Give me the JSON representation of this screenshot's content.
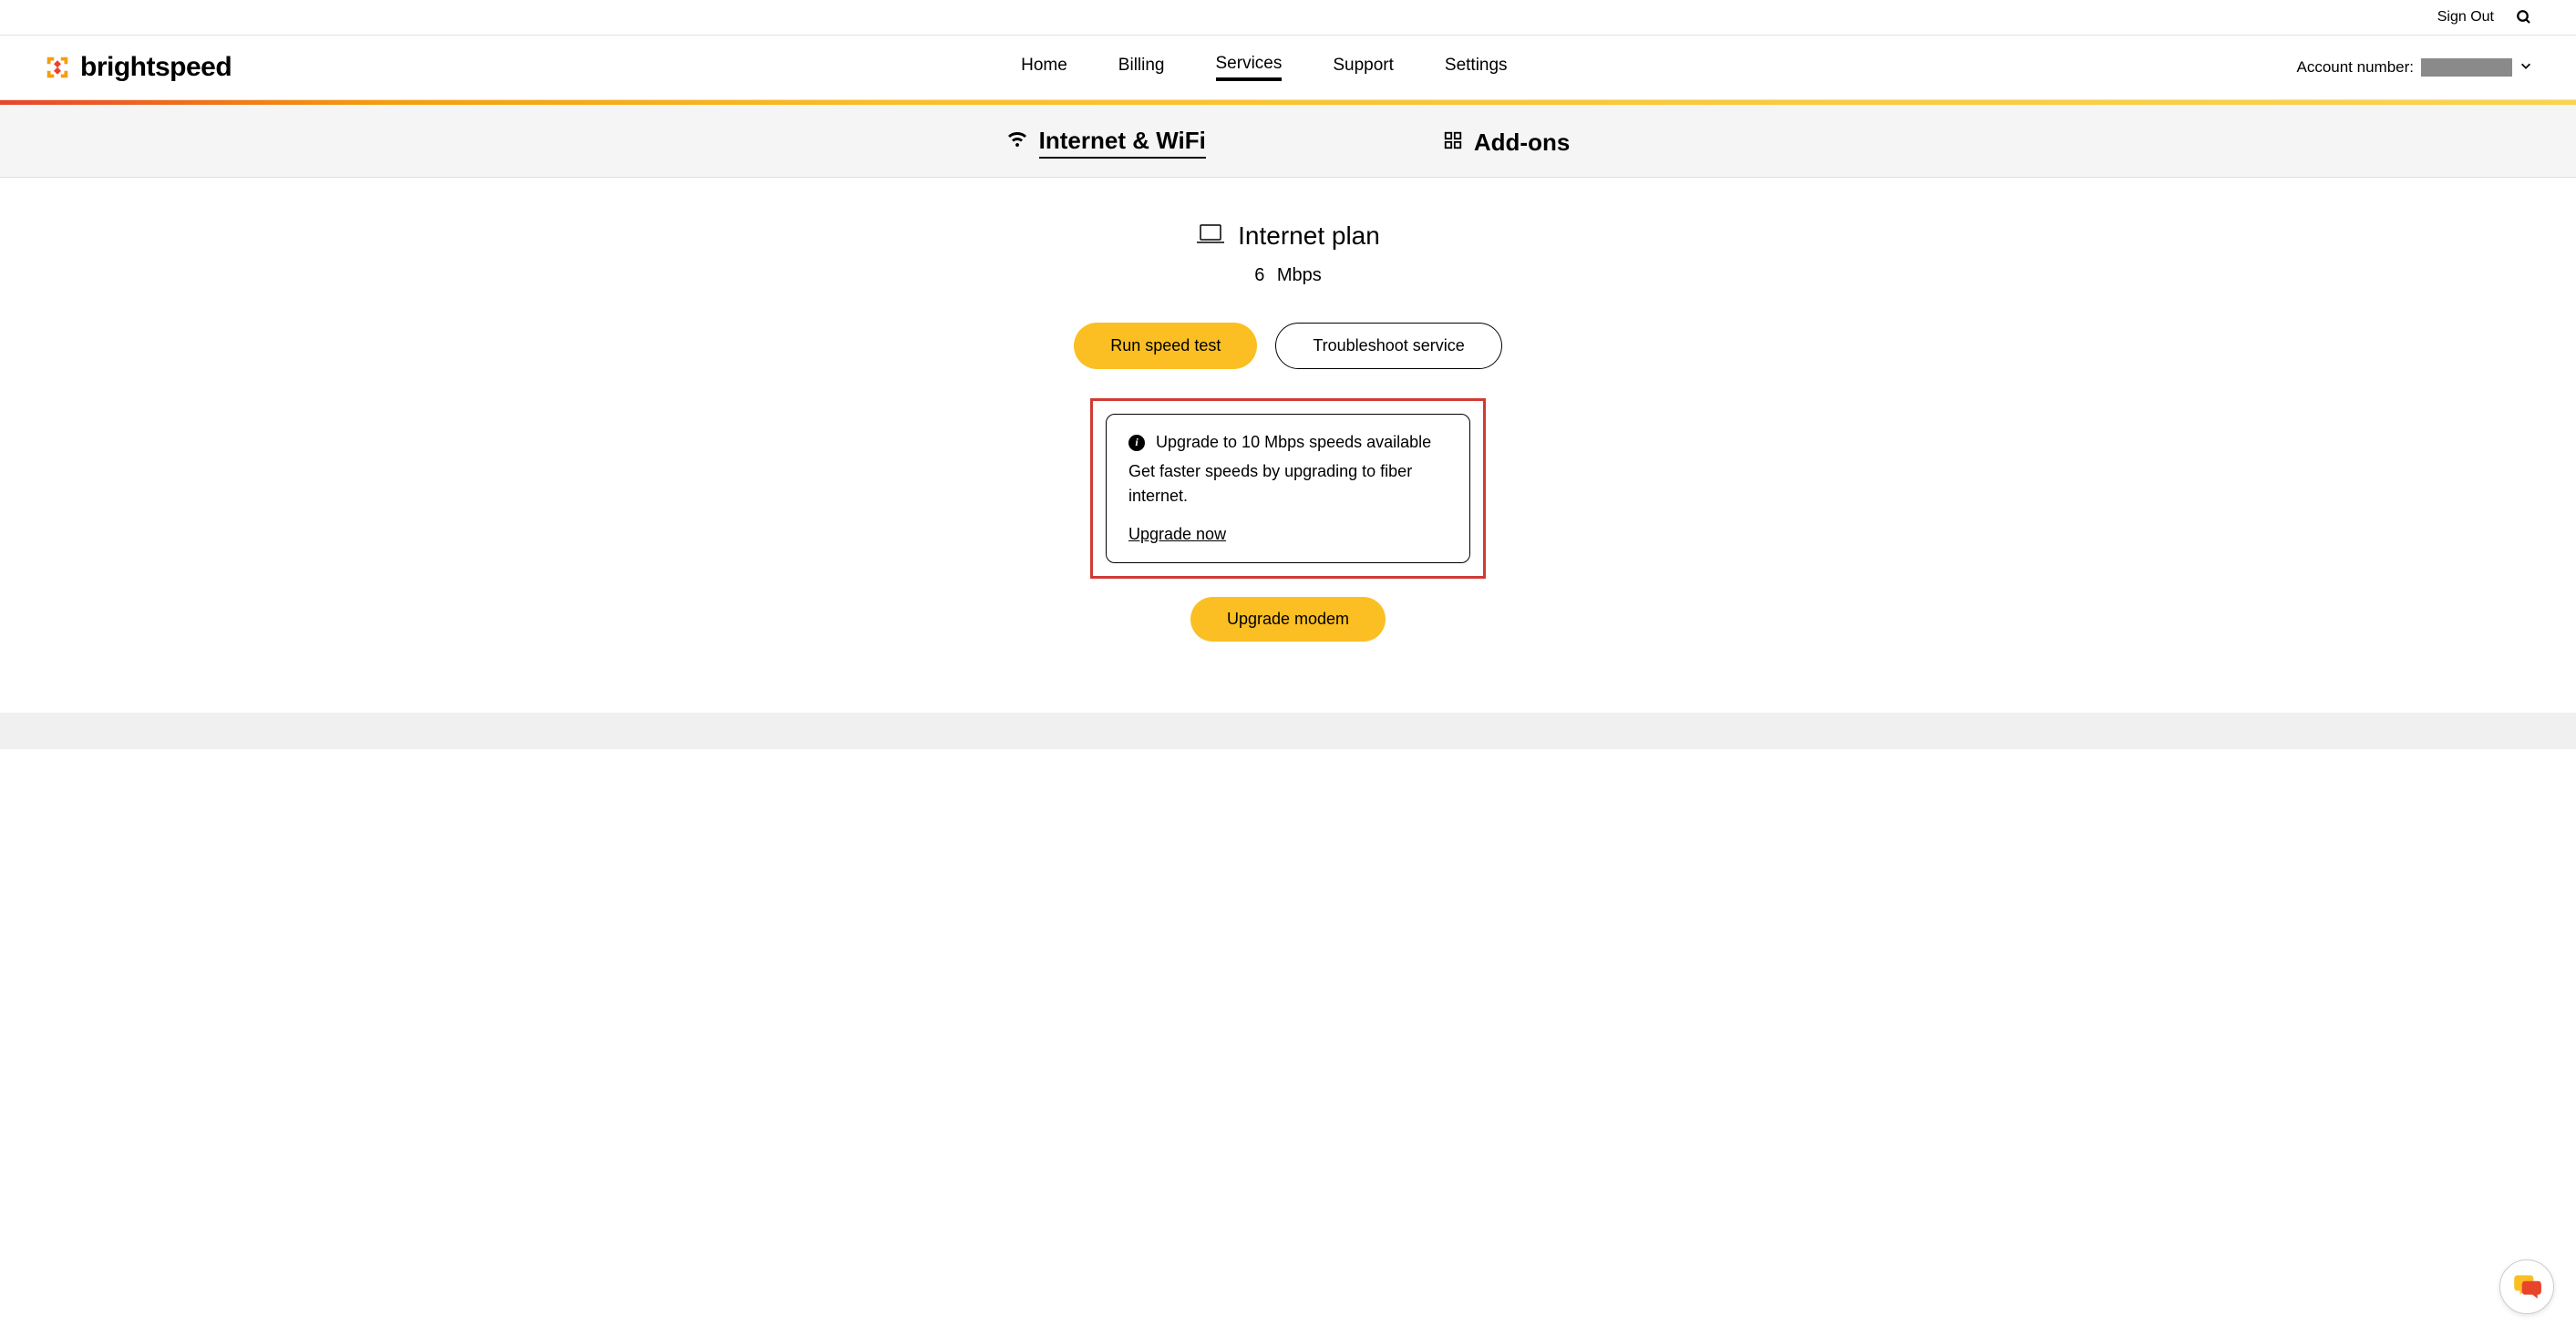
{
  "topbar": {
    "sign_out": "Sign Out"
  },
  "header": {
    "brand": "brightspeed",
    "nav": {
      "home": "Home",
      "billing": "Billing",
      "services": "Services",
      "support": "Support",
      "settings": "Settings"
    },
    "account_label": "Account number:"
  },
  "tabs": {
    "internet_wifi": "Internet & WiFi",
    "addons": "Add-ons"
  },
  "plan": {
    "title": "Internet plan",
    "speed_value": "6",
    "speed_unit": "Mbps"
  },
  "buttons": {
    "speed_test": "Run speed test",
    "troubleshoot": "Troubleshoot service",
    "upgrade_modem": "Upgrade modem"
  },
  "upgrade_card": {
    "title": "Upgrade to 10 Mbps speeds available",
    "description": "Get faster speeds by upgrading to fiber internet.",
    "link": "Upgrade now"
  }
}
